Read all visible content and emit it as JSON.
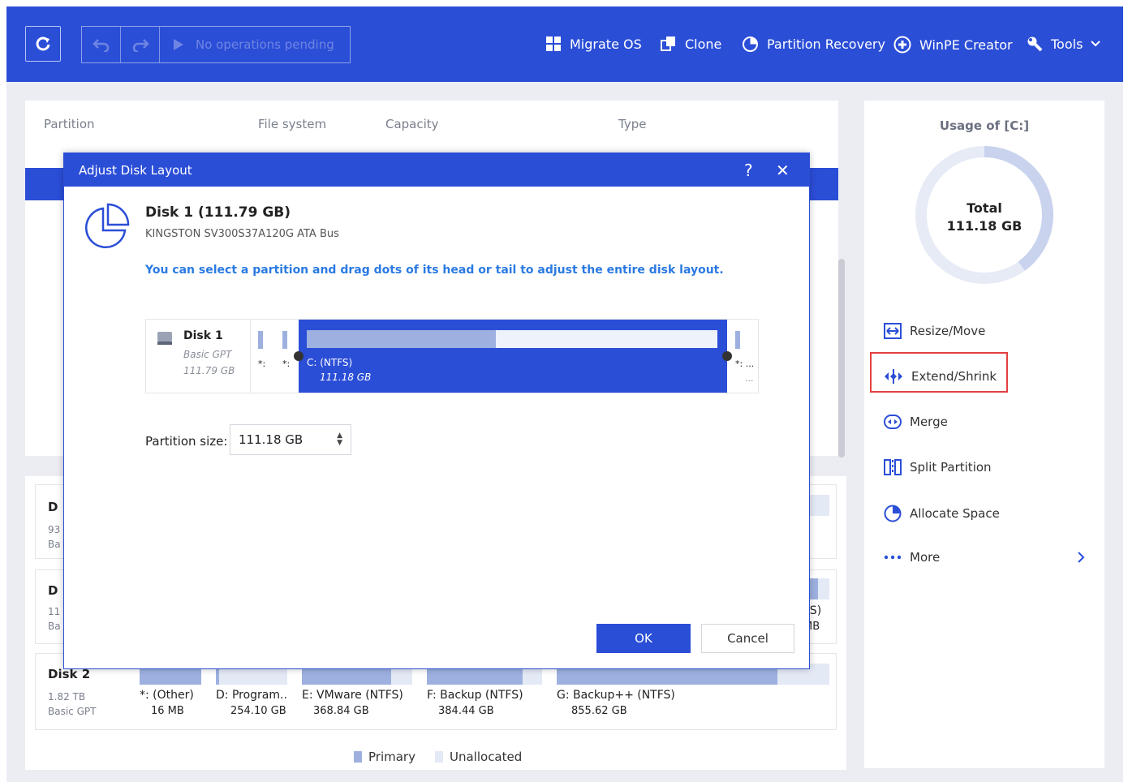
{
  "toolbar": {
    "refresh_icon": "refresh-icon",
    "undo_icon": "undo-icon",
    "redo_icon": "redo-icon",
    "pending_text": "No operations pending",
    "nav": [
      {
        "label": "Migrate OS",
        "icon": "windows-icon"
      },
      {
        "label": "Clone",
        "icon": "clone-icon"
      },
      {
        "label": "Partition Recovery",
        "icon": "pie-icon"
      },
      {
        "label": "WinPE Creator",
        "icon": "plus-circle-icon"
      },
      {
        "label": "Tools",
        "icon": "wrench-icon"
      }
    ]
  },
  "table": {
    "columns": [
      "Partition",
      "File system",
      "Capacity",
      "Type"
    ]
  },
  "disks": [
    {
      "name": "D",
      "line1": "93",
      "line2": "Ba"
    },
    {
      "name": "D",
      "line1": "11",
      "line2": "Ba",
      "clip1": "FS)",
      "clip2": "MB"
    },
    {
      "name": "Disk 2",
      "size": "1.82 TB",
      "type": "Basic GPT",
      "partitions": [
        {
          "label": "*: (Other)",
          "size": "16 MB"
        },
        {
          "label": "D: Program..",
          "size": "254.10 GB"
        },
        {
          "label": "E: VMware (NTFS)",
          "size": "368.84 GB"
        },
        {
          "label": "F: Backup (NTFS)",
          "size": "384.44 GB"
        },
        {
          "label": "G: Backup++ (NTFS)",
          "size": "855.62 GB"
        }
      ]
    }
  ],
  "legend": {
    "primary": "Primary",
    "unallocated": "Unallocated"
  },
  "usage": {
    "title": "Usage of [C:]",
    "total_label": "Total",
    "total_value": "111.18 GB",
    "used_fraction": 0.4
  },
  "actions": [
    {
      "label": "Resize/Move",
      "icon": "resize-icon"
    },
    {
      "label": "Extend/Shrink",
      "icon": "extend-shrink-icon"
    },
    {
      "label": "Merge",
      "icon": "merge-icon"
    },
    {
      "label": "Split Partition",
      "icon": "split-icon"
    },
    {
      "label": "Allocate Space",
      "icon": "allocate-icon"
    },
    {
      "label": "More",
      "icon": "more-dots-icon"
    }
  ],
  "modal": {
    "title": "Adjust Disk Layout",
    "help": "?",
    "close": "✕",
    "disk_title": "Disk 1 (111.79 GB)",
    "disk_model": "KINGSTON SV300S37A120G ATA Bus",
    "hint": "You can select a partition and drag dots of its head or tail to adjust the entire disk layout.",
    "layout": {
      "disk_name": "Disk 1",
      "disk_type": "Basic GPT",
      "disk_size": "111.79 GB",
      "small_label_1": "*:",
      "small_label_2": "*:",
      "c_label": "C: (NTFS)",
      "c_size": "111.18 GB",
      "c_used_fraction": 0.46,
      "tail_label": "*: ...",
      "tail_dots": "..."
    },
    "partition_size_label": "Partition size:",
    "partition_size_value": "111.18 GB",
    "ok": "OK",
    "cancel": "Cancel"
  }
}
